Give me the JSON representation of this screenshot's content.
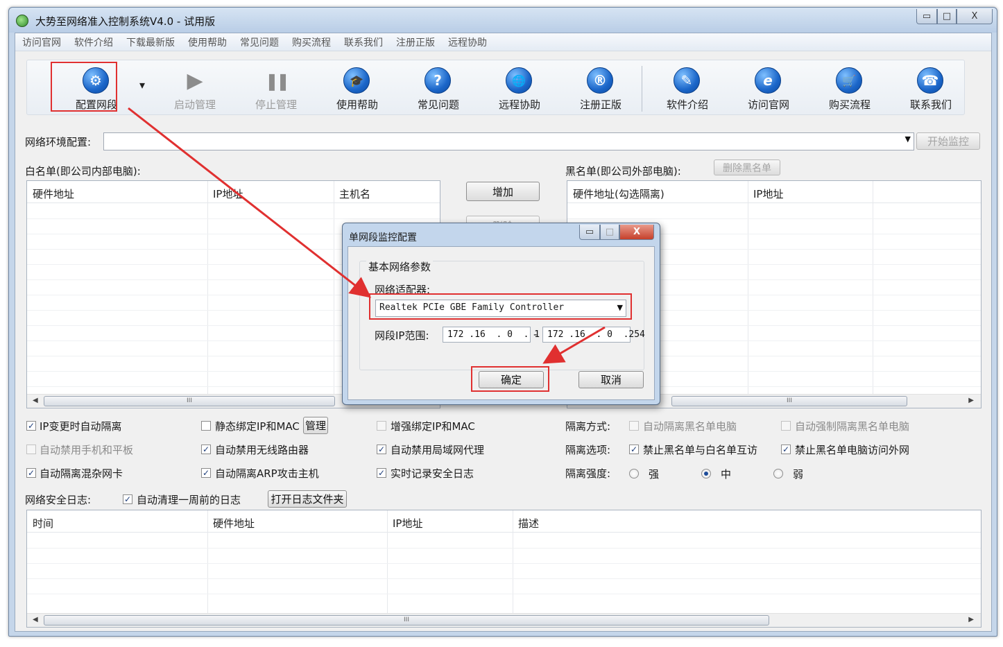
{
  "window": {
    "title": "大势至网络准入控制系统V4.0 - 试用版",
    "controls": {
      "minimize": "▭",
      "maximize": "□",
      "close": "X"
    }
  },
  "menu": [
    "访问官网",
    "软件介绍",
    "下载最新版",
    "使用帮助",
    "常见问题",
    "购买流程",
    "联系我们",
    "注册正版",
    "远程协助"
  ],
  "toolbar": {
    "dropdown_glyph": "▾",
    "buttons": [
      {
        "label": "配置网段",
        "icon": "gear-icon",
        "glyph": "⚙"
      },
      {
        "label": "启动管理",
        "icon": "play-icon",
        "glyph": "▶"
      },
      {
        "label": "停止管理",
        "icon": "pause-icon",
        "glyph": "❚❚"
      },
      {
        "label": "使用帮助",
        "icon": "graduation-cap-icon",
        "glyph": "🎓"
      },
      {
        "label": "常见问题",
        "icon": "question-icon",
        "glyph": "?"
      },
      {
        "label": "远程协助",
        "icon": "globe-icon",
        "glyph": "🌐"
      },
      {
        "label": "注册正版",
        "icon": "registered-icon",
        "glyph": "®"
      },
      {
        "label": "软件介绍",
        "icon": "edit-icon",
        "glyph": "✎"
      },
      {
        "label": "访问官网",
        "icon": "ie-browser-icon",
        "glyph": "e"
      },
      {
        "label": "购买流程",
        "icon": "cart-icon",
        "glyph": "🛒"
      },
      {
        "label": "联系我们",
        "icon": "phone-icon",
        "glyph": "☎"
      }
    ]
  },
  "env": {
    "label": "网络环境配置:",
    "value": "",
    "start_button": "开始监控"
  },
  "whitelist": {
    "label": "白名单(即公司内部电脑):",
    "columns": [
      "硬件地址",
      "IP地址",
      "主机名"
    ],
    "add_button": "增加",
    "delete_button": "删除",
    "scroll_grip": "III"
  },
  "blacklist": {
    "label": "黑名单(即公司外部电脑):",
    "delete_button": "删除黑名单",
    "columns": [
      "硬件地址(勾选隔离)",
      "IP地址"
    ],
    "scroll_grip": "III"
  },
  "options": {
    "ip_change_isolate": {
      "label": "IP变更时自动隔离",
      "checked": true
    },
    "static_bind": {
      "label": "静态绑定IP和MAC",
      "checked": false
    },
    "manage_button": "管理",
    "enhanced_bind": {
      "label": "增强绑定IP和MAC",
      "checked": false
    },
    "isolation_method_label": "隔离方式:",
    "auto_isolate_blacklist": {
      "label": "自动隔离黑名单电脑",
      "checked": false
    },
    "force_isolate_blacklist": {
      "label": "自动强制隔离黑名单电脑",
      "checked": false
    },
    "ban_mobile": {
      "label": "自动禁用手机和平板",
      "checked": false
    },
    "ban_wireless_router": {
      "label": "自动禁用无线路由器",
      "checked": true
    },
    "ban_lan_proxy": {
      "label": "自动禁用局域网代理",
      "checked": true
    },
    "isolation_options_label": "隔离选项:",
    "ban_black_white_access": {
      "label": "禁止黑名单与白名单互访",
      "checked": true
    },
    "ban_black_internet": {
      "label": "禁止黑名单电脑访问外网",
      "checked": true
    },
    "isolate_promiscuous": {
      "label": "自动隔离混杂网卡",
      "checked": true
    },
    "isolate_arp_attacker": {
      "label": "自动隔离ARP攻击主机",
      "checked": true
    },
    "realtime_log": {
      "label": "实时记录安全日志",
      "checked": true
    },
    "isolation_strength_label": "隔离强度:",
    "strength": {
      "options": [
        "强",
        "中",
        "弱"
      ],
      "selected": "中"
    }
  },
  "log": {
    "label": "网络安全日志:",
    "auto_clean": {
      "label": "自动清理一周前的日志",
      "checked": true
    },
    "open_folder_button": "打开日志文件夹",
    "columns": [
      "时间",
      "硬件地址",
      "IP地址",
      "描述"
    ],
    "scroll_grip": "III"
  },
  "dialog": {
    "title": "单网段监控配置",
    "group_title": "基本网络参数",
    "adapter_label": "网络适配器:",
    "adapter_value": "Realtek PCIe GBE Family Controller",
    "range_label": "网段IP范围:",
    "range_start": "172 .16  . 0  . 1",
    "range_separator": "-",
    "range_end": "172 .16  . 0  .254",
    "ok_button": "确定",
    "cancel_button": "取消"
  },
  "colors": {
    "annotation_red": "#e03030",
    "window_frame": "#c5d6ea",
    "icon_blue": "#1b66c9"
  }
}
